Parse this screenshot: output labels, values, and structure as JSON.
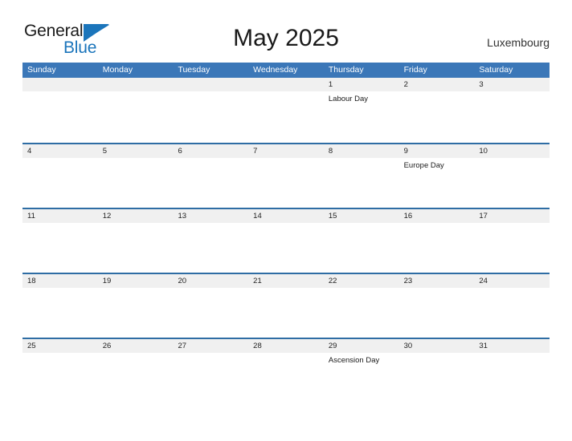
{
  "branding": {
    "logo_text_primary": "General",
    "logo_text_secondary": "Blue",
    "logo_icon": "triangle-flag-icon",
    "primary_color": "#1b75bb",
    "header_color": "#3b77b8",
    "row_divider_color": "#2e6da4",
    "date_strip_color": "#f0f0f0"
  },
  "header": {
    "title": "May 2025",
    "location": "Luxembourg"
  },
  "calendar": {
    "weekdays": [
      "Sunday",
      "Monday",
      "Tuesday",
      "Wednesday",
      "Thursday",
      "Friday",
      "Saturday"
    ],
    "weeks": [
      [
        {
          "date": "",
          "events": []
        },
        {
          "date": "",
          "events": []
        },
        {
          "date": "",
          "events": []
        },
        {
          "date": "",
          "events": []
        },
        {
          "date": "1",
          "events": [
            "Labour Day"
          ]
        },
        {
          "date": "2",
          "events": []
        },
        {
          "date": "3",
          "events": []
        }
      ],
      [
        {
          "date": "4",
          "events": []
        },
        {
          "date": "5",
          "events": []
        },
        {
          "date": "6",
          "events": []
        },
        {
          "date": "7",
          "events": []
        },
        {
          "date": "8",
          "events": []
        },
        {
          "date": "9",
          "events": [
            "Europe Day"
          ]
        },
        {
          "date": "10",
          "events": []
        }
      ],
      [
        {
          "date": "11",
          "events": []
        },
        {
          "date": "12",
          "events": []
        },
        {
          "date": "13",
          "events": []
        },
        {
          "date": "14",
          "events": []
        },
        {
          "date": "15",
          "events": []
        },
        {
          "date": "16",
          "events": []
        },
        {
          "date": "17",
          "events": []
        }
      ],
      [
        {
          "date": "18",
          "events": []
        },
        {
          "date": "19",
          "events": []
        },
        {
          "date": "20",
          "events": []
        },
        {
          "date": "21",
          "events": []
        },
        {
          "date": "22",
          "events": []
        },
        {
          "date": "23",
          "events": []
        },
        {
          "date": "24",
          "events": []
        }
      ],
      [
        {
          "date": "25",
          "events": []
        },
        {
          "date": "26",
          "events": []
        },
        {
          "date": "27",
          "events": []
        },
        {
          "date": "28",
          "events": []
        },
        {
          "date": "29",
          "events": [
            "Ascension Day"
          ]
        },
        {
          "date": "30",
          "events": []
        },
        {
          "date": "31",
          "events": []
        }
      ]
    ]
  }
}
